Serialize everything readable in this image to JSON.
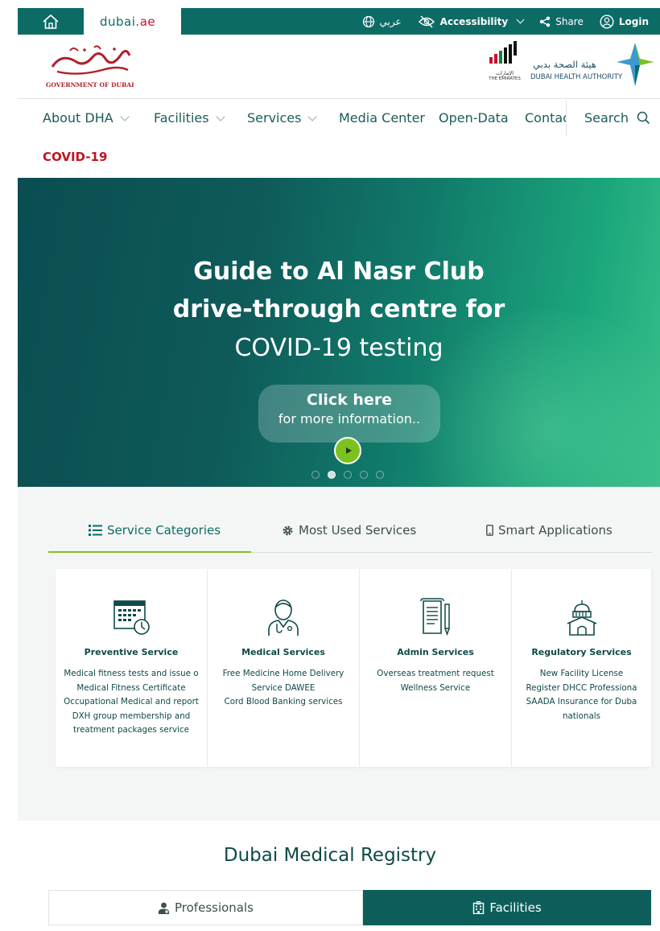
{
  "topbar": {
    "portal_name": "dubai",
    "portal_suffix": ".ae",
    "language": "عربي",
    "accessibility": "Accessibility",
    "share": "Share",
    "login": "Login"
  },
  "logos": {
    "government_of_dubai": "GOVERNMENT OF DUBAI",
    "dha_name_ar": "هيئة الصحة بدبي",
    "dha_name_en": "DUBAI HEALTH AUTHORITY",
    "the_emirates": "THE EMIRATES",
    "emirates_ar": "الإمارات"
  },
  "nav": {
    "items": [
      "About DHA",
      "Facilities",
      "Services",
      "Media Center",
      "Open-Data",
      "Contac"
    ],
    "search_label": "Search",
    "covid_link": "COVID-19"
  },
  "hero": {
    "title_line1": "Guide to Al Nasr Club",
    "title_line2": "drive-through centre for",
    "title_line3": "COVID-19 testing",
    "cta_line1": "Click here",
    "cta_line2": "for more information..",
    "slide_count": 5,
    "active_slide": 2
  },
  "service_tabs": {
    "items": [
      "Service Categories",
      "Most Used Services",
      "Smart Applications"
    ],
    "active": "Service Categories"
  },
  "service_cards": [
    {
      "title": "Preventive Service",
      "icon": "calendar-clock-icon",
      "lines": [
        "Medical fitness tests and issue o",
        "Medical Fitness Certificate",
        "Occupational Medical and report",
        "DXH group membership and",
        "treatment packages service"
      ]
    },
    {
      "title": "Medical Services",
      "icon": "doctor-icon",
      "lines": [
        "Free Medicine Home Delivery",
        "Service DAWEE",
        "Cord Blood Banking services"
      ]
    },
    {
      "title": "Admin Services",
      "icon": "document-pen-icon",
      "lines": [
        "Overseas treatment request",
        "Wellness Service"
      ]
    },
    {
      "title": "Regulatory Services",
      "icon": "government-building-icon",
      "lines": [
        "New Facility License",
        "Register DHCC Professiona",
        "SAADA Insurance for Duba",
        "nationals"
      ]
    }
  ],
  "registry": {
    "title": "Dubai Medical Registry",
    "tabs": [
      "Professionals",
      "Facilities"
    ],
    "active": "Facilities"
  },
  "colors": {
    "brand_teal": "#0d6b66",
    "dark_teal": "#0d5e5a",
    "accent_green": "#7cc21e",
    "covid_red": "#c0141f"
  }
}
